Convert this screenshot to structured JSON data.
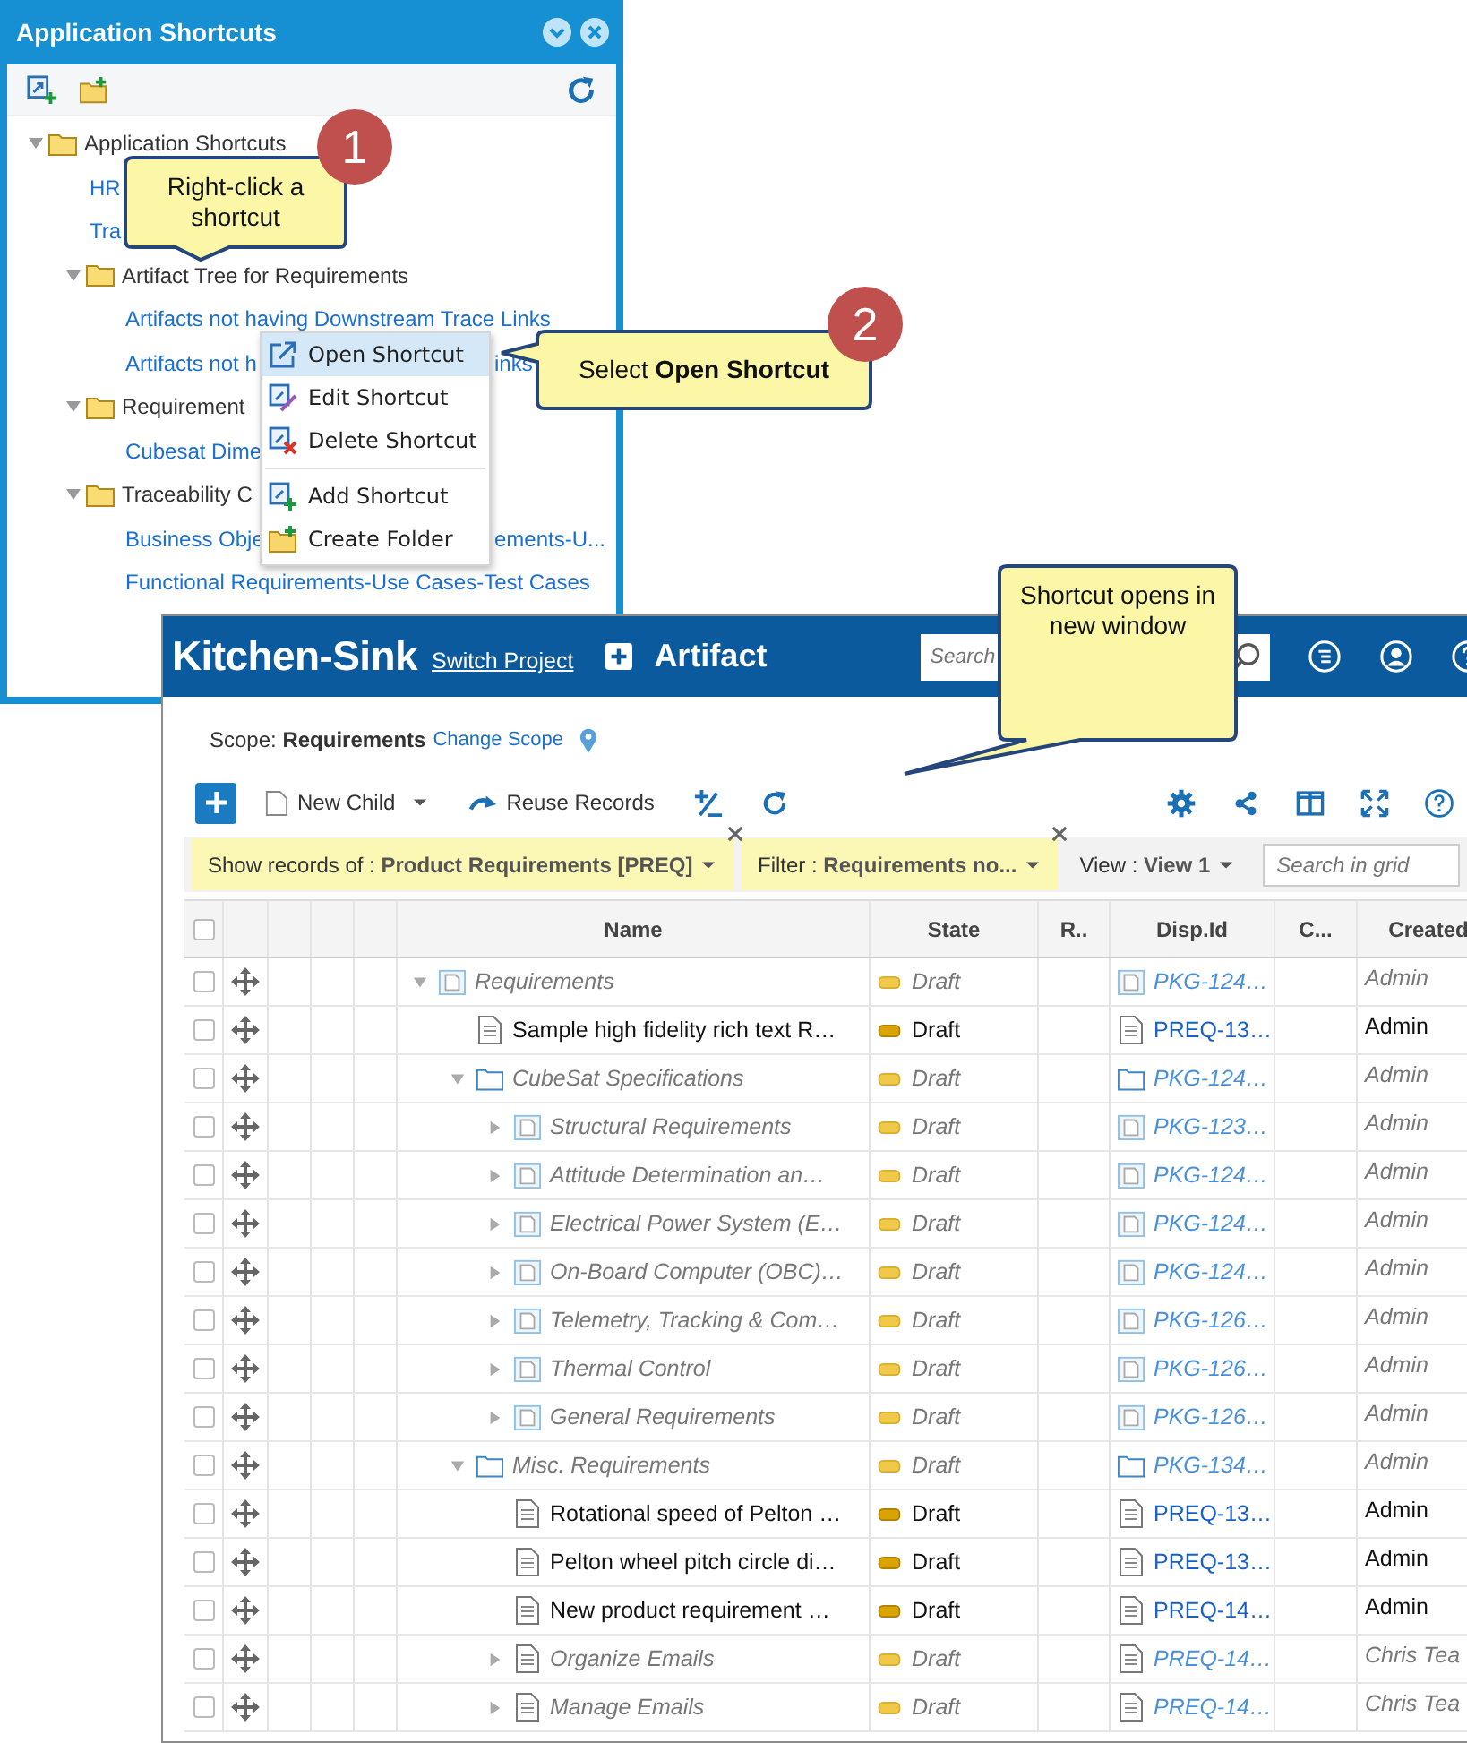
{
  "panel": {
    "title": "Application Shortcuts",
    "tree": [
      {
        "kind": "folder",
        "label": "Application Shortcuts",
        "expanded": true,
        "children": [
          {
            "kind": "link",
            "label": "HR"
          },
          {
            "kind": "link",
            "label": "Tra"
          },
          {
            "kind": "folder",
            "label": "Artifact Tree for Requirements",
            "expanded": true,
            "children": [
              {
                "kind": "link",
                "label": "Artifacts not having Downstream Trace Links"
              },
              {
                "kind": "link",
                "label": "Artifacts not h",
                "tail": "inks"
              }
            ]
          },
          {
            "kind": "folder",
            "label": "Requirement",
            "expanded": true,
            "children": [
              {
                "kind": "link",
                "label": "Cubesat Dime"
              }
            ]
          },
          {
            "kind": "folder",
            "label": "Traceability C",
            "expanded": true,
            "children": [
              {
                "kind": "link",
                "label": "Business Obje",
                "tail": "ements-U..."
              },
              {
                "kind": "link",
                "label": "Functional Requirements-Use Cases-Test Cases"
              }
            ]
          }
        ]
      }
    ]
  },
  "context_menu": {
    "groups": [
      [
        {
          "kind": "open",
          "label": "Open Shortcut",
          "selected": true
        },
        {
          "kind": "edit",
          "label": "Edit Shortcut",
          "selected": false
        },
        {
          "kind": "delete",
          "label": "Delete Shortcut",
          "selected": false
        }
      ],
      [
        {
          "kind": "add",
          "label": "Add Shortcut",
          "selected": false
        },
        {
          "kind": "folder",
          "label": "Create Folder",
          "selected": false
        }
      ]
    ]
  },
  "callouts": [
    {
      "badge": "1",
      "text": "Right-click a shortcut"
    },
    {
      "badge": "2",
      "text": "Select **Open Shortcut**"
    },
    {
      "text": "Shortcut opens in new window"
    }
  ],
  "app": {
    "project": "Kitchen-Sink",
    "switch_link": "Switch Project",
    "module": "Artifact",
    "search": {
      "placeholder": "Search"
    },
    "scope": "Scope: **Requirements**",
    "change_scope": "Change Scope",
    "toolbar": {
      "new_child": "New Child",
      "reuse": "Reuse Records"
    },
    "filters": [
      {
        "text": "Show records of : **Product Requirements [PREQ]**"
      },
      {
        "text": "Filter : **Requirements no...**"
      }
    ],
    "view": "View : **View 1**",
    "grid_search": {
      "placeholder": "Search in grid"
    },
    "table": {
      "select_all": {
        "checked": false
      },
      "columns": [
        "Name",
        "State",
        "R..",
        "Disp.Id",
        "C...",
        "Created"
      ],
      "rows": [
        {
          "name": "Requirements",
          "kind": "package",
          "expanded": true,
          "dimmed": true,
          "checked": false,
          "state": "Draft",
          "disp_id": "PKG-124…",
          "created": "Admin",
          "children": [
            {
              "name": "Sample high fidelity rich text R…",
              "kind": "requirement",
              "dimmed": false,
              "checked": false,
              "state": "Draft",
              "disp_id": "PREQ-13…",
              "created": "Admin"
            },
            {
              "name": "CubeSat Specifications",
              "kind": "folder",
              "expanded": true,
              "dimmed": true,
              "checked": false,
              "state": "Draft",
              "disp_id": "PKG-124…",
              "created": "Admin",
              "children": [
                {
                  "name": "Structural Requirements",
                  "kind": "package",
                  "expanded": false,
                  "dimmed": true,
                  "checked": false,
                  "state": "Draft",
                  "disp_id": "PKG-123…",
                  "created": "Admin"
                },
                {
                  "name": "Attitude Determination an…",
                  "kind": "package",
                  "expanded": false,
                  "dimmed": true,
                  "checked": false,
                  "state": "Draft",
                  "disp_id": "PKG-124…",
                  "created": "Admin"
                },
                {
                  "name": "Electrical Power System (E…",
                  "kind": "package",
                  "expanded": false,
                  "dimmed": true,
                  "checked": false,
                  "state": "Draft",
                  "disp_id": "PKG-124…",
                  "created": "Admin"
                },
                {
                  "name": "On-Board Computer (OBC)…",
                  "kind": "package",
                  "expanded": false,
                  "dimmed": true,
                  "checked": false,
                  "state": "Draft",
                  "disp_id": "PKG-124…",
                  "created": "Admin"
                },
                {
                  "name": "Telemetry, Tracking & Com…",
                  "kind": "package",
                  "expanded": false,
                  "dimmed": true,
                  "checked": false,
                  "state": "Draft",
                  "disp_id": "PKG-126…",
                  "created": "Admin"
                },
                {
                  "name": "Thermal Control",
                  "kind": "package",
                  "expanded": false,
                  "dimmed": true,
                  "checked": false,
                  "state": "Draft",
                  "disp_id": "PKG-126…",
                  "created": "Admin"
                },
                {
                  "name": "General Requirements",
                  "kind": "package",
                  "expanded": false,
                  "dimmed": true,
                  "checked": false,
                  "state": "Draft",
                  "disp_id": "PKG-126…",
                  "created": "Admin"
                }
              ]
            },
            {
              "name": "Misc. Requirements",
              "kind": "folder",
              "expanded": true,
              "dimmed": true,
              "checked": false,
              "state": "Draft",
              "disp_id": "PKG-134…",
              "created": "Admin",
              "children": [
                {
                  "name": "Rotational speed of Pelton …",
                  "kind": "requirement",
                  "dimmed": false,
                  "checked": false,
                  "state": "Draft",
                  "disp_id": "PREQ-13…",
                  "created": "Admin"
                },
                {
                  "name": "Pelton wheel pitch circle di…",
                  "kind": "requirement",
                  "dimmed": false,
                  "checked": false,
                  "state": "Draft",
                  "disp_id": "PREQ-13…",
                  "created": "Admin"
                },
                {
                  "name": "New product requirement …",
                  "kind": "requirement",
                  "dimmed": false,
                  "checked": false,
                  "state": "Draft",
                  "disp_id": "PREQ-14…",
                  "created": "Admin"
                },
                {
                  "name": "Organize Emails",
                  "kind": "requirement",
                  "expanded": false,
                  "dimmed": true,
                  "checked": false,
                  "state": "Draft",
                  "disp_id": "PREQ-14…",
                  "created": "Chris Tea"
                },
                {
                  "name": "Manage Emails",
                  "kind": "requirement",
                  "expanded": false,
                  "dimmed": true,
                  "checked": false,
                  "state": "Draft",
                  "disp_id": "PREQ-14…",
                  "created": "Chris Tea"
                }
              ]
            }
          ]
        }
      ]
    }
  }
}
